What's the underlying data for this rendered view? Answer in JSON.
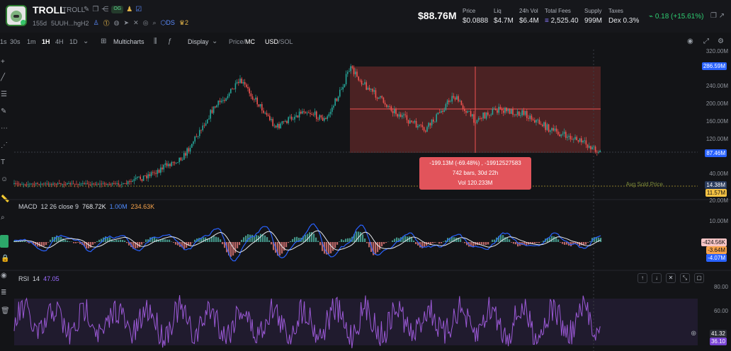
{
  "header": {
    "title": "TROLL",
    "ticker": "TROLL",
    "og_badge": "OG",
    "age": "155d",
    "address": "5UUH...hgH2",
    "ds_label": "DS",
    "crown_count": "2",
    "price_big": "$88.76M",
    "stats": [
      {
        "label": "Price",
        "value": "$0.0888"
      },
      {
        "label": "Liq",
        "value": "$4.7M"
      },
      {
        "label": "24h Vol",
        "value": "$6.4M"
      },
      {
        "label": "Total Fees",
        "value": "2,525.40"
      },
      {
        "label": "Supply",
        "value": "999M"
      },
      {
        "label": "Taxes",
        "value": "Dex 0.3%"
      }
    ],
    "change": "0.18 (+15.61%)"
  },
  "toolbar": {
    "timeframes": [
      "1s",
      "30s",
      "1m",
      "1H",
      "4H",
      "1D"
    ],
    "active_timeframe": "1H",
    "multicharts": "Multicharts",
    "display": "Display",
    "price_mc_a": "Price",
    "price_mc_sep": "/",
    "price_mc_b": "MC",
    "usd_sol_a": "USD",
    "usd_sol_sep": "/",
    "usd_sol_b": "SOL"
  },
  "measure_tooltip": {
    "line1": "-199.13M (-69.48%) , -19912527583",
    "line2": "742 bars, 30d 22h",
    "line3": "Vol 120.233M"
  },
  "price_axis": {
    "ticks": [
      "320.00M",
      "240.00M",
      "200.00M",
      "160.00M",
      "120.00M",
      "40.00M",
      "20.00M"
    ],
    "tags": [
      {
        "text": "286.59M",
        "color": "#2962ff"
      },
      {
        "text": "87.46M",
        "color": "#2962ff"
      },
      {
        "text": "14.38M",
        "color": "#2a3b5c"
      },
      {
        "text": "11.57M",
        "color": "#f6c344"
      }
    ],
    "avg_sold_label": "Avg Sold Price"
  },
  "macd": {
    "label": "MACD",
    "params": "12 26 close 9",
    "v1": "768.72K",
    "v2": "1.00M",
    "v3": "234.63K",
    "ticks": [
      "10.00M"
    ],
    "tags": [
      {
        "text": "-424.56K",
        "color": "#f8c6c6"
      },
      {
        "text": "-3.64M",
        "color": "#f5a24b"
      },
      {
        "text": "-4.07M",
        "color": "#2962ff"
      }
    ]
  },
  "rsi": {
    "label": "RSI",
    "period": "14",
    "value": "47.05",
    "ticks": [
      "80.00",
      "60.00"
    ],
    "tags": [
      {
        "text": "41.32",
        "color": "#2a2d35"
      },
      {
        "text": "36.10",
        "color": "#7b45d6"
      }
    ]
  },
  "colors": {
    "up": "#26a69a",
    "down": "#ef5350",
    "measure_fill": "#7a2e2e",
    "rsi": "#9b59d6",
    "macd_line": "#2962ff",
    "signal_line": "#e6e8ec"
  }
}
